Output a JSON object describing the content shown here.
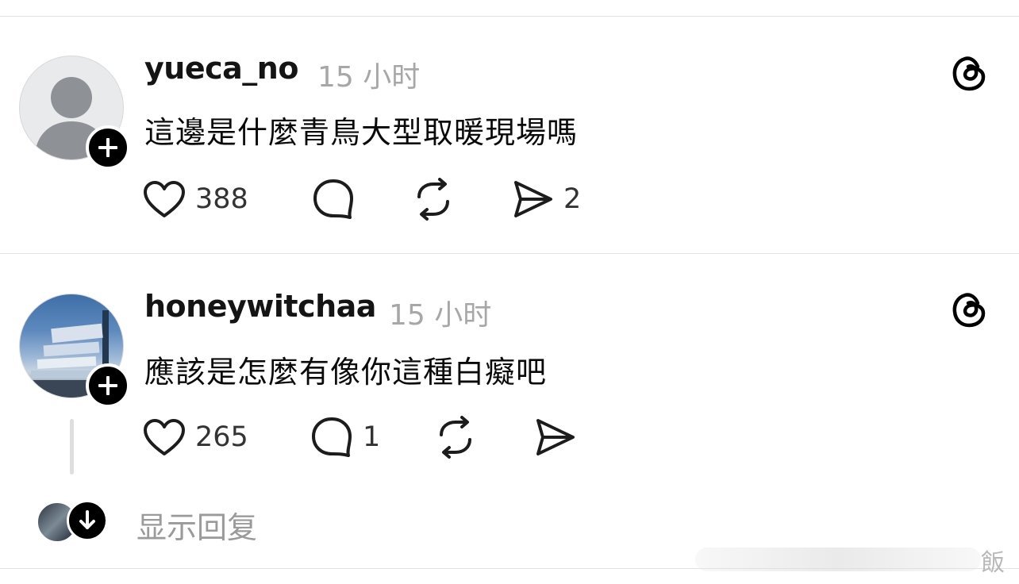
{
  "posts": [
    {
      "username": "yueca_no",
      "time": "15 小时",
      "text": "這邊是什麼青鳥大型取暖現場嗎",
      "likes": "388",
      "replies": "",
      "reposts": "",
      "shares": "2",
      "avatar": "default-person-icon"
    },
    {
      "username": "honeywitchaa",
      "time": "15 小时",
      "text": "應該是怎麼有像你這種白癡吧",
      "likes": "265",
      "replies": "1",
      "reposts": "",
      "shares": "",
      "avatar": "photo"
    }
  ],
  "show_replies": "显示回复",
  "watermark": "飯",
  "colors": {
    "text": "#101010",
    "muted": "#a7a7a7",
    "divider": "#e3e3e3",
    "badge": "#000000"
  }
}
